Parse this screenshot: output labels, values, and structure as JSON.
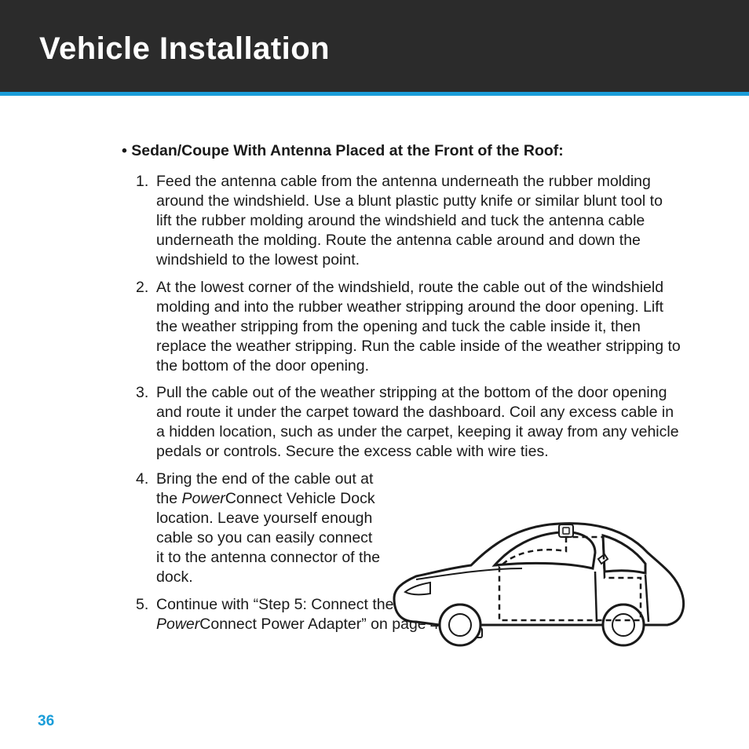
{
  "header": {
    "title": "Vehicle Installation"
  },
  "section": {
    "heading": "Sedan/Coupe With Antenna Placed at the Front of the Roof:",
    "steps": {
      "s1": "Feed the antenna cable from the antenna underneath the rubber molding around the windshield. Use a blunt plastic putty knife or similar blunt tool to lift the rubber molding around the windshield and tuck the antenna cable underneath the molding. Route the antenna cable around and down the windshield to the lowest point.",
      "s2": "At the lowest corner of the windshield, route the cable out of the windshield molding and into the rubber weather stripping around the door opening. Lift the weather stripping from the opening and tuck the cable inside it, then replace the weather stripping. Run the cable inside of the weather stripping to the bottom of the door opening.",
      "s3": "Pull the cable out of the weather stripping at the bottom of the door opening and route it under the carpet toward the dashboard. Coil any excess cable in a hidden location, such as under the carpet, keeping it away from any vehicle pedals or controls. Secure the excess cable with wire ties.",
      "s4_a": "Bring the end of the cable out at the ",
      "s4_pc1": "Power",
      "s4_b": "Connect Vehicle Dock location. Leave yourself enough cable so you can easily connect it to the antenna connector of the dock.",
      "s5_a": "Continue with “Step 5: Connect the Magnetic Mount Antenna and ",
      "s5_pc": "Power",
      "s5_b": "Connect Power Adapter” on page 41."
    }
  },
  "page_number": "36",
  "colors": {
    "accent": "#1a9dd9",
    "header_bg": "#2b2b2b"
  }
}
